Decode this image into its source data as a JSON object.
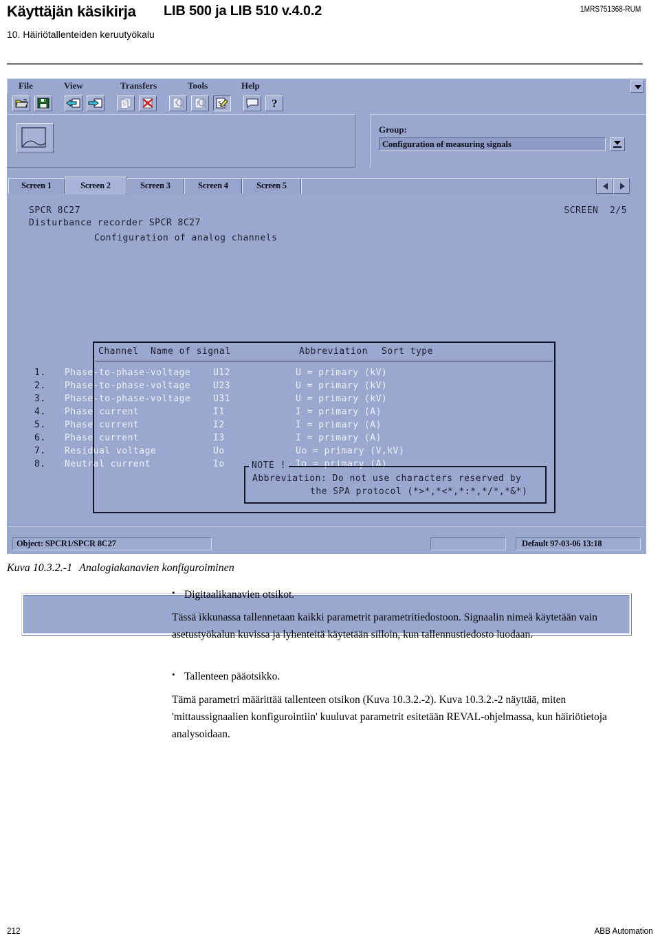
{
  "header": {
    "manual_title": "Käyttäjän käsikirja",
    "product_title": "LIB 500 ja LIB 510 v.4.0.2",
    "doc_id": "1MRS751368-RUM",
    "chapter": "10. Häiriötallenteiden keruutyökalu"
  },
  "app": {
    "menus": [
      "File",
      "View",
      "Transfers",
      "Tools",
      "Help"
    ],
    "toolbar_icons": [
      "open-folder-icon",
      "save-disk-icon",
      "transfer-in-icon",
      "transfer-out-icon",
      "copy-settings-icon",
      "delete-settings-icon",
      "view-settings-icon",
      "view-recordings-icon",
      "edit-settings-icon",
      "note-icon",
      "help-question-icon"
    ],
    "big_button_icon": "screen-shape-icon",
    "group": {
      "label": "Group:",
      "selected": "Configuration of measuring signals",
      "dropdown_icon": "dropdown-arrow-icon"
    },
    "tabs": [
      {
        "label": "Screen 1",
        "active": false
      },
      {
        "label": "Screen 2",
        "active": true
      },
      {
        "label": "Screen 3",
        "active": false
      },
      {
        "label": "Screen 4",
        "active": false
      },
      {
        "label": "Screen 5",
        "active": false
      }
    ],
    "tab_nav": {
      "prev_icon": "triangle-left-icon",
      "next_icon": "triangle-right-icon"
    },
    "terminal": {
      "device_id": "SPCR 8C27",
      "device_desc": "Disturbance recorder SPCR 8C27",
      "section_title": "Configuration of analog channels",
      "screen_indicator": "SCREEN  2/5",
      "table": {
        "headers": {
          "channel": "Channel",
          "name": "Name of signal",
          "abbreviation": "Abbreviation",
          "sort_type": "Sort type"
        },
        "rows": [
          {
            "channel": "1.",
            "name": "Phase-to-phase-voltage",
            "abbreviation": "U12",
            "sort_type": "U = primary (kV)"
          },
          {
            "channel": "2.",
            "name": "Phase-to-phase-voltage",
            "abbreviation": "U23",
            "sort_type": "U = primary (kV)"
          },
          {
            "channel": "3.",
            "name": "Phase-to-phase-voltage",
            "abbreviation": "U31",
            "sort_type": "U = primary (kV)"
          },
          {
            "channel": "4.",
            "name": "Phase current",
            "abbreviation": "I1",
            "sort_type": "I = primary (A)"
          },
          {
            "channel": "5.",
            "name": "Phase current",
            "abbreviation": "I2",
            "sort_type": "I = primary (A)"
          },
          {
            "channel": "6.",
            "name": "Phase current",
            "abbreviation": "I3",
            "sort_type": "I = primary (A)"
          },
          {
            "channel": "7.",
            "name": "Residual voltage",
            "abbreviation": "Uo",
            "sort_type": "Uo = primary (V,kV)"
          },
          {
            "channel": "8.",
            "name": "Neutral current",
            "abbreviation": "Io",
            "sort_type": "Io = primary (A)"
          }
        ]
      },
      "note": {
        "title": "NOTE !",
        "line1": "Abbreviation: Do not use characters reserved by",
        "line2": "the SPA protocol (*>*,*<*,*:*,*/*,*&*)"
      }
    },
    "statusbar": {
      "object": "Object: SPCR1/SPCR 8C27",
      "middle": "",
      "right": "Default  97-03-06 13:18"
    }
  },
  "figure": {
    "caption_number": "Kuva 10.3.2.-1",
    "caption_text": "Analogiakanavien konfiguroiminen"
  },
  "body": {
    "bullet1": "Digitaalikanavien otsikot.",
    "para1": "Tässä ikkunassa tallennetaan kaikki parametrit parametritiedostoon. Signaalin nimeä käytetään vain asetustyökalun kuvissa ja lyhenteitä käytetään silloin, kun tallennustiedosto luodaan.",
    "bullet2": "Tallenteen pääotsikko.",
    "para2": "Tämä parametri määrittää tallenteen otsikon (Kuva 10.3.2.-2). Kuva 10.3.2.-2 näyttää, miten 'mittaussignaalien konfigurointiin' kuuluvat parametrit esitetään REVAL-ohjelmassa, kun häiriötietoja analysoidaan."
  },
  "footer": {
    "page_number": "212",
    "company": "ABB Automation"
  },
  "colors": {
    "app_background": "#9aa8cf",
    "terminal_text": "#1c1c30",
    "signal_text": "#eef1fa",
    "page_background": "#ffffff"
  }
}
